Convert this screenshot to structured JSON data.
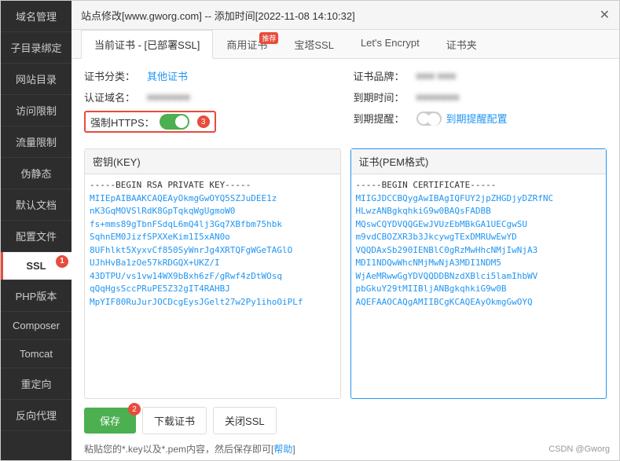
{
  "title": "站点修改[www.gworg.com] -- 添加时间[2022-11-08 14:10:32]",
  "close_icon": "×",
  "tabs": [
    {
      "id": "current",
      "label": "当前证书 - [已部署SSL]",
      "active": true
    },
    {
      "id": "commercial",
      "label": "商用证书",
      "active": false,
      "badge": "推荐"
    },
    {
      "id": "btssl",
      "label": "宝塔SSL",
      "active": false
    },
    {
      "id": "letsencrypt",
      "label": "Let's Encrypt",
      "active": false
    },
    {
      "id": "certfile",
      "label": "证书夹",
      "active": false
    }
  ],
  "info_left": {
    "cert_type_label": "证书分类：",
    "cert_type_value": "其他证书",
    "cert_domain_label": "认证域名：",
    "cert_domain_value": "*.gworg.com",
    "https_label": "强制HTTPS：",
    "https_enabled": true,
    "https_badge": "3"
  },
  "info_right": {
    "cert_brand_label": "证书品牌：",
    "cert_brand_value": "■■■ ■■■",
    "expire_time_label": "到期时间：",
    "expire_time_value": "■■■■■",
    "expire_remind_label": "到期提醒：",
    "expire_remind_value": "到期提醒配置"
  },
  "key_panel": {
    "title": "密钥(KEY)",
    "content": [
      "-----BEGIN RSA PRIVATE KEY-----",
      "MIIEpAIBAAKCAQEAyOkmgGwOYQ5SZJuDEE1z",
      "nK3GqMOVSlRdK8GpTqkqWgUgmoW0",
      "fs+mms89gTbnFSdqL6mQ4lj3Gq7XBfbm75hbk",
      "SqhnEM0JizfSPXXeKim1I5xAN0o",
      "8UFhlkt5XyxvCf850SyWnrJg4XRTQFgWGeTAGlO",
      "UJhHvBa1zOe57kRDGQX+UKZ/I",
      "43DTPU/vs1vw14WX9bBxh6zF/gRwf4zDtWOsq",
      "qQqHgsSccPRuPE5Z32gIT4RAHBJ",
      "MpYIF80RuJurJOCDcgEysJGelt27w2Py1ihoOiPLf"
    ]
  },
  "cert_panel": {
    "title": "证书(PEM格式)",
    "content": [
      "-----BEGIN CERTIFICATE-----",
      "MIIGJDCCBQygAwIBAgIQFUY2jpZHGDjyDZRfNC",
      "HLwzANBgkqhkiG9w0BAQsFADBB",
      "MQswCQYDVQQGEwJVUzEbMBkGA1UECgwSU",
      "m9vdCBOZXR3b3JkcywgTExDMRUwEwYD",
      "VQQDAxSb290IENBlC0gRzMwHhcNMjIwNjA3",
      "MDI1NDQwWhcNMjMwNjA3MDI1NDM5",
      "WjAeMRwwGgYDVQQDDBNzdXBlci5lamIhbWV",
      "pbGkuY29tMIIBljANBgkqhkiG9w0B",
      "AQEFAAOCAQgAMIIBCgKCAQEAyOkmgGwOYQ ▼"
    ]
  },
  "sidebar": {
    "items": [
      {
        "label": "域名管理",
        "active": false
      },
      {
        "label": "子目录绑定",
        "active": false
      },
      {
        "label": "网站目录",
        "active": false
      },
      {
        "label": "访问限制",
        "active": false
      },
      {
        "label": "流量限制",
        "active": false
      },
      {
        "label": "伪静态",
        "active": false
      },
      {
        "label": "默认文档",
        "active": false
      },
      {
        "label": "配置文件",
        "active": false
      },
      {
        "label": "SSL",
        "active": true,
        "badge": "1"
      },
      {
        "label": "PHP版本",
        "active": false
      },
      {
        "label": "Composer",
        "active": false
      },
      {
        "label": "Tomcat",
        "active": false
      },
      {
        "label": "重定向",
        "active": false
      },
      {
        "label": "反向代理",
        "active": false
      }
    ]
  },
  "buttons": {
    "save": "保存",
    "save_badge": "2",
    "download": "下载证书",
    "close_ssl": "关闭SSL"
  },
  "hint": {
    "text": "粘贴您的*.key以及*.pem内容，然后保存即可[",
    "link": "帮助",
    "text_end": "]"
  },
  "watermark": "CSDN @Gworg"
}
